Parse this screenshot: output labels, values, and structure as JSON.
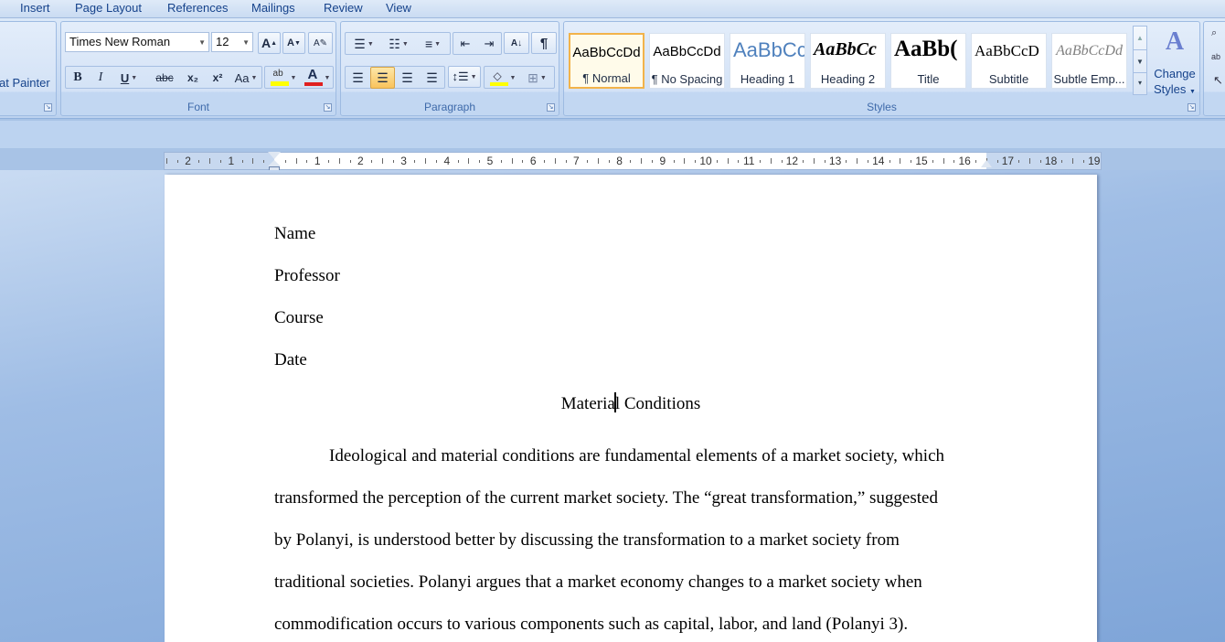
{
  "tabs": [
    "Insert",
    "Page Layout",
    "References",
    "Mailings",
    "Review",
    "View"
  ],
  "clipboard": {
    "format_painter_label": "at Painter"
  },
  "font": {
    "group_label": "Font",
    "face": "Times New Roman",
    "size": "12",
    "bold": "B",
    "italic": "I",
    "underline": "U",
    "strike": "abc",
    "subscript": "x₂",
    "superscript": "x²",
    "case": "Aa",
    "grow": "A",
    "shrink": "A",
    "highlight_color": "#ffff00",
    "font_color": "#e02020"
  },
  "paragraph": {
    "group_label": "Paragraph",
    "pilcrow": "¶"
  },
  "styles": {
    "group_label": "Styles",
    "items": [
      {
        "sample": "AaBbCcDd",
        "name": "¶ Normal"
      },
      {
        "sample": "AaBbCcDd",
        "name": "¶ No Spacing"
      },
      {
        "sample": "AaBbCc",
        "name": "Heading 1"
      },
      {
        "sample": "AaBbCc",
        "name": "Heading 2"
      },
      {
        "sample": "AaBb(",
        "name": "Title"
      },
      {
        "sample": "AaBbCcD",
        "name": "Subtitle"
      },
      {
        "sample": "AaBbCcDd",
        "name": "Subtle Emp..."
      }
    ],
    "change_styles": {
      "icon_text": "A",
      "line1": "Change",
      "line2": "Styles"
    }
  },
  "ruler": {
    "labels": [
      "2",
      "1",
      "1",
      "2",
      "3",
      "4",
      "5",
      "6",
      "7",
      "8",
      "9",
      "10",
      "11",
      "12",
      "13",
      "14",
      "15",
      "16",
      "17",
      "18",
      "19"
    ]
  },
  "document": {
    "header_lines": [
      "Name",
      "Professor",
      "Course",
      "Date"
    ],
    "title_before_caret": "Materia",
    "title_after_caret": "l Conditions",
    "body_lines": [
      "Ideological and material conditions are fundamental elements of a market society, which",
      "transformed the perception of the current market society. The “great transformation,” suggested",
      "by Polanyi, is understood better by discussing the transformation to a market society from",
      "traditional societies. Polanyi argues that a market economy changes to a market society when",
      "commodification occurs to various components such as capital, labor, and land (Polanyi 3)."
    ]
  }
}
